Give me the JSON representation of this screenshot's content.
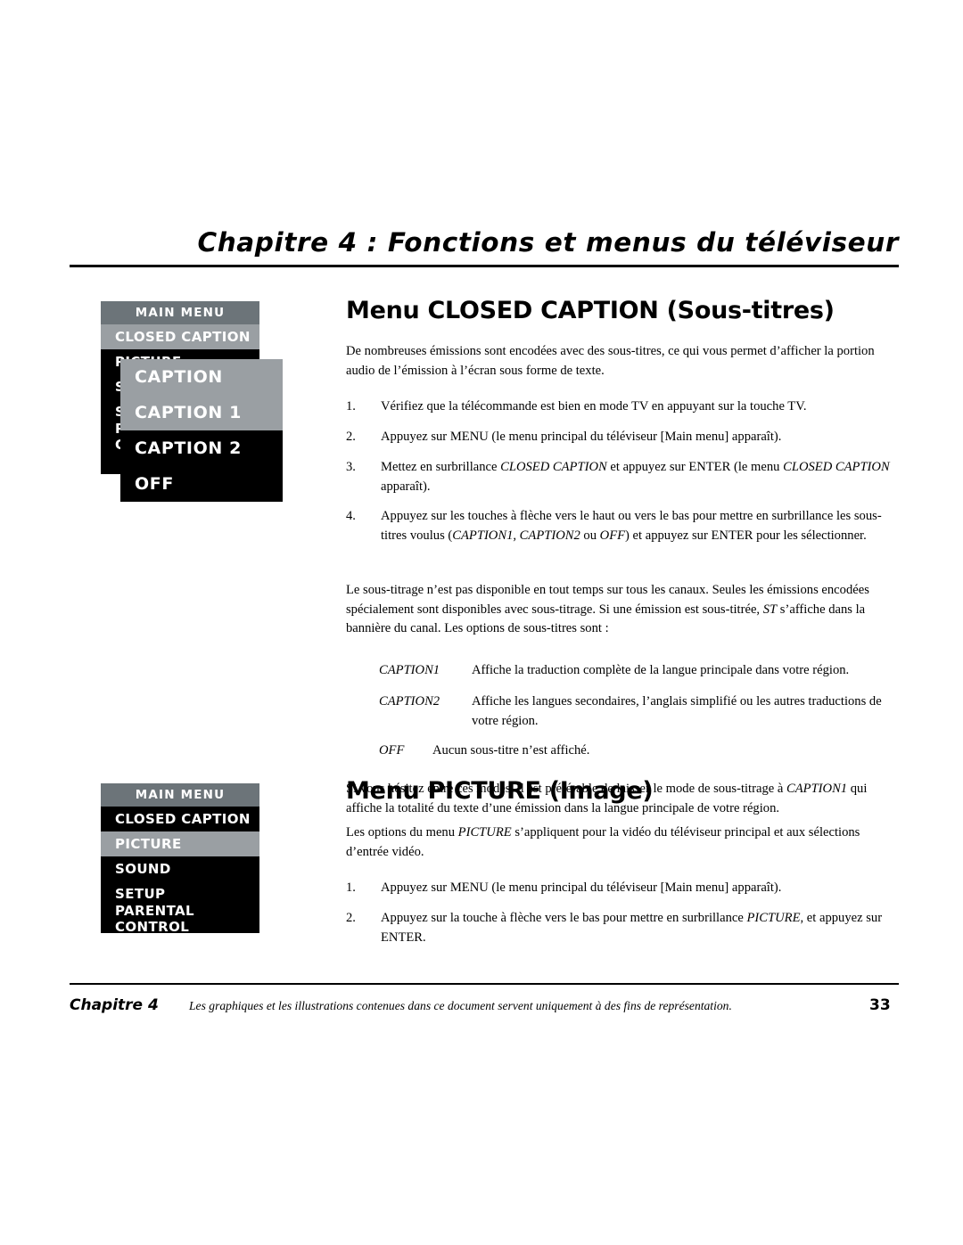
{
  "header": {
    "chapter_title": "Chapitre 4 : Fonctions et menus du téléviseur"
  },
  "sections": [
    {
      "heading": "Menu CLOSED CAPTION (Sous-titres)",
      "intro": "De nombreuses émissions sont encodées avec des sous-titres, ce qui vous permet d’afficher la portion audio de l’émission à l’écran sous forme de texte.",
      "steps": [
        {
          "num": "1.",
          "text_html": "Vérifiez que la télécommande est bien en mode TV en appuyant sur la touche TV."
        },
        {
          "num": "2.",
          "text_html": "Appuyez sur MENU (le menu principal du téléviseur [Main menu] apparaît)."
        },
        {
          "num": "3.",
          "text_html": "Mettez en surbrillance <i>CLOSED CAPTION</i> et appuyez sur ENTER (le menu <i>CLOSED CAPTION</i> apparaît)."
        },
        {
          "num": "4.",
          "text_html": "Appuyez sur les touches à flèche vers le haut ou vers le bas pour mettre en surbrillance les sous-titres voulus (<i>CAPTION1, CAPTION2</i> ou <i>OFF</i>) et appuyez sur ENTER pour les sélectionner."
        }
      ],
      "paragraph2": "Le sous-titrage n’est pas disponible en tout temps sur tous les canaux. Seules les émissions encodées spécialement sont disponibles avec sous-titrage. Si une émission est sous-titrée, <i>ST</i> s’affiche dans la bannière du canal. Les options de sous-titres sont :",
      "definitions": [
        {
          "term": "CAPTION1",
          "text": "Affiche la traduction complète de la langue principale dans votre région."
        },
        {
          "term": "CAPTION2",
          "text": "Affiche les langues secondaires, l’anglais simplifié ou les autres traductions de votre région."
        },
        {
          "term": "OFF",
          "text": "Aucun sous-titre n’est affiché."
        }
      ],
      "paragraph3": "Si vous hésitez entre ces modes, il est préférable de laisser le mode de sous-titrage à <i>CAPTION1</i> qui affiche la totalité du texte d’une émission dans la langue principale de votre région."
    },
    {
      "heading": "Menu PICTURE (Image)",
      "intro": "Les options du menu <i>PICTURE</i> s’appliquent pour la vidéo du téléviseur principal et aux sélections d’entrée vidéo.",
      "steps": [
        {
          "num": "1.",
          "text_html": "Appuyez sur MENU (le menu principal du téléviseur [Main menu] apparaît)."
        },
        {
          "num": "2.",
          "text_html": "Appuyez sur la touche à flèche vers le bas pour mettre en surbrillance <i>PICTURE</i>,  et appuyez sur ENTER."
        }
      ]
    }
  ],
  "menus": {
    "main_menu_1": {
      "header": "MAIN MENU",
      "items": [
        {
          "label": "CLOSED CAPTION",
          "highlighted": true
        },
        {
          "label": "PICTURE",
          "highlighted": false
        },
        {
          "label": "SOUND",
          "highlighted": false
        },
        {
          "label": "SETUP",
          "highlighted": false
        },
        {
          "label": "PARENTAL CONTROL",
          "highlighted": false
        }
      ]
    },
    "caption_menu": {
      "title": "CAPTION",
      "items": [
        {
          "label": "CAPTION 1",
          "highlighted": true
        },
        {
          "label": "CAPTION 2",
          "highlighted": false
        },
        {
          "label": "OFF",
          "highlighted": false
        }
      ]
    },
    "main_menu_2": {
      "header": "MAIN MENU",
      "items": [
        {
          "label": "CLOSED CAPTION",
          "highlighted": false
        },
        {
          "label": "PICTURE",
          "highlighted": true
        },
        {
          "label": "SOUND",
          "highlighted": false
        },
        {
          "label": "SETUP",
          "highlighted": false
        },
        {
          "label": "PARENTAL CONTROL",
          "highlighted": false
        }
      ]
    }
  },
  "footer": {
    "chapter": "Chapitre 4",
    "note": "Les graphiques et les illustrations contenues dans ce document servent uniquement à des fins de représentation.",
    "page": "33"
  }
}
